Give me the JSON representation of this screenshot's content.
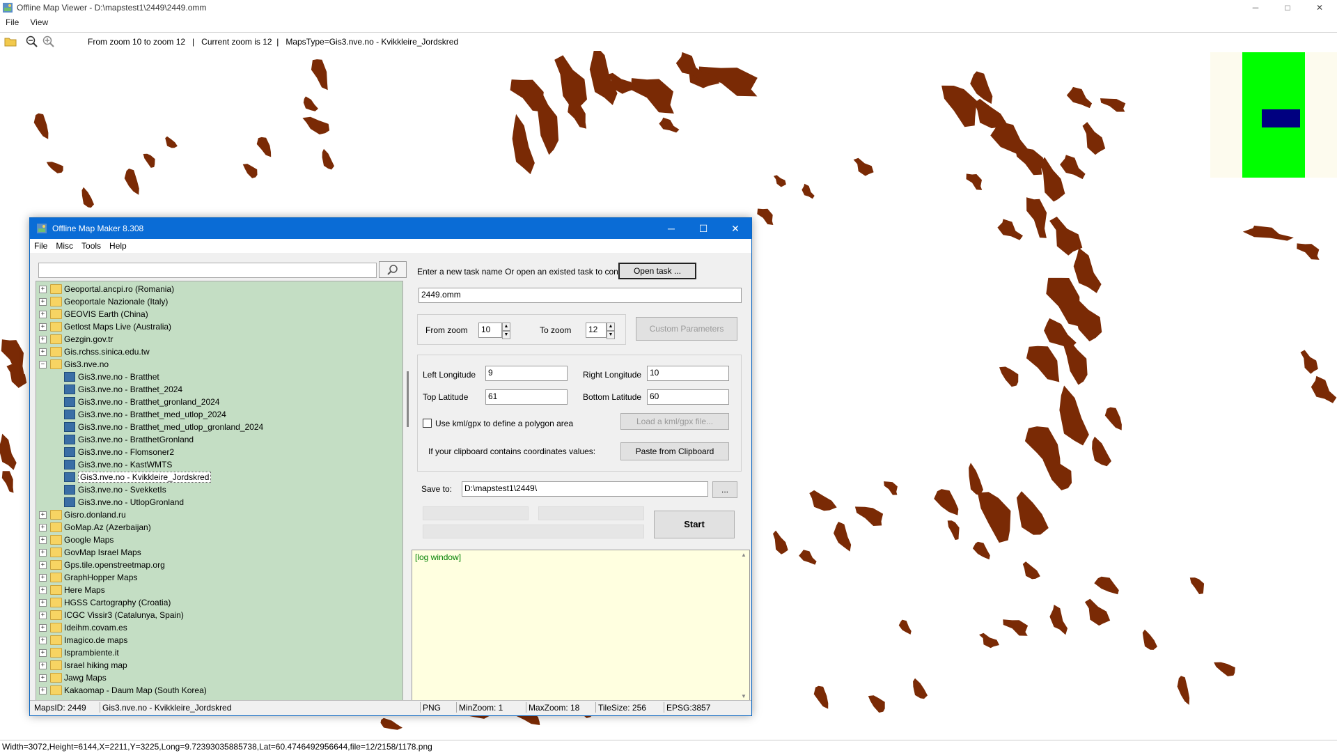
{
  "viewer": {
    "title": "Offline Map Viewer - D:\\mapstest1\\2449\\2449.omm",
    "menu": [
      "File",
      "View"
    ],
    "toolbar_info": "From zoom 10 to zoom 12   |   Current zoom is 12  |   MapsType=Gis3.nve.no - Kvikkleire_Jordskred",
    "status": "Width=3072,Height=6144,X=2211,Y=3225,Long=9.72393035885738,Lat=60.4746492956644,file=12/2158/1178.png",
    "window_controls": {
      "minimize": "─",
      "maximize": "□",
      "close": "✕"
    },
    "map_feature_color": "#7a2a05",
    "icons": [
      "open-folder-icon",
      "zoom-out-icon",
      "zoom-in-icon"
    ]
  },
  "dialog": {
    "title": "Offline Map Maker 8.308",
    "menu": [
      "File",
      "Misc",
      "Tools",
      "Help"
    ],
    "window_controls": {
      "minimize": "─",
      "maximize": "☐",
      "close": "✕"
    },
    "tree": [
      {
        "label": "Geoportal.ancpi.ro (Romania)",
        "level": 0,
        "type": "folder",
        "exp": "+"
      },
      {
        "label": "Geoportale Nazionale (Italy)",
        "level": 0,
        "type": "folder",
        "exp": "+"
      },
      {
        "label": "GEOVIS Earth (China)",
        "level": 0,
        "type": "folder",
        "exp": "+"
      },
      {
        "label": "Getlost Maps Live (Australia)",
        "level": 0,
        "type": "folder",
        "exp": "+"
      },
      {
        "label": "Gezgin.gov.tr",
        "level": 0,
        "type": "folder",
        "exp": "+"
      },
      {
        "label": "Gis.rchss.sinica.edu.tw",
        "level": 0,
        "type": "folder",
        "exp": "+"
      },
      {
        "label": "Gis3.nve.no",
        "level": 0,
        "type": "folder",
        "exp": "−"
      },
      {
        "label": "Gis3.nve.no - Bratthet",
        "level": 1,
        "type": "map"
      },
      {
        "label": "Gis3.nve.no - Bratthet_2024",
        "level": 1,
        "type": "map"
      },
      {
        "label": "Gis3.nve.no - Bratthet_gronland_2024",
        "level": 1,
        "type": "map"
      },
      {
        "label": "Gis3.nve.no - Bratthet_med_utlop_2024",
        "level": 1,
        "type": "map"
      },
      {
        "label": "Gis3.nve.no - Bratthet_med_utlop_gronland_2024",
        "level": 1,
        "type": "map"
      },
      {
        "label": "Gis3.nve.no - BratthetGronland",
        "level": 1,
        "type": "map"
      },
      {
        "label": "Gis3.nve.no - Flomsoner2",
        "level": 1,
        "type": "map"
      },
      {
        "label": "Gis3.nve.no - KastWMTS",
        "level": 1,
        "type": "map"
      },
      {
        "label": "Gis3.nve.no - Kvikkleire_Jordskred",
        "level": 1,
        "type": "map",
        "selected": true
      },
      {
        "label": "Gis3.nve.no - SvekketIs",
        "level": 1,
        "type": "map"
      },
      {
        "label": "Gis3.nve.no - UtlopGronland",
        "level": 1,
        "type": "map"
      },
      {
        "label": "Gisro.donland.ru",
        "level": 0,
        "type": "folder",
        "exp": "+"
      },
      {
        "label": "GoMap.Az (Azerbaijan)",
        "level": 0,
        "type": "folder",
        "exp": "+"
      },
      {
        "label": "Google Maps",
        "level": 0,
        "type": "folder",
        "exp": "+"
      },
      {
        "label": "GovMap Israel Maps",
        "level": 0,
        "type": "folder",
        "exp": "+"
      },
      {
        "label": "Gps.tile.openstreetmap.org",
        "level": 0,
        "type": "folder",
        "exp": "+"
      },
      {
        "label": "GraphHopper Maps",
        "level": 0,
        "type": "folder",
        "exp": "+"
      },
      {
        "label": "Here Maps",
        "level": 0,
        "type": "folder",
        "exp": "+"
      },
      {
        "label": "HGSS Cartography (Croatia)",
        "level": 0,
        "type": "folder",
        "exp": "+"
      },
      {
        "label": "ICGC Vissir3 (Catalunya, Spain)",
        "level": 0,
        "type": "folder",
        "exp": "+"
      },
      {
        "label": "Ideihm.covam.es",
        "level": 0,
        "type": "folder",
        "exp": "+"
      },
      {
        "label": "Imagico.de maps",
        "level": 0,
        "type": "folder",
        "exp": "+"
      },
      {
        "label": "Isprambiente.it",
        "level": 0,
        "type": "folder",
        "exp": "+"
      },
      {
        "label": "Israel hiking map",
        "level": 0,
        "type": "folder",
        "exp": "+"
      },
      {
        "label": "Jawg Maps",
        "level": 0,
        "type": "folder",
        "exp": "+"
      },
      {
        "label": "Kakaomap - Daum Map (South Korea)",
        "level": 0,
        "type": "folder",
        "exp": "+"
      }
    ],
    "task": {
      "prompt": "Enter a new task name Or open an existed task to continue:",
      "open_button": "Open task ...",
      "name_value": "2449.omm"
    },
    "zoom": {
      "from_label": "From zoom",
      "from_value": "10",
      "to_label": "To zoom",
      "to_value": "12",
      "custom_button": "Custom Parameters"
    },
    "coords": {
      "left_lon_label": "Left Longitude",
      "left_lon": "9",
      "right_lon_label": "Right Longitude",
      "right_lon": "10",
      "top_lat_label": "Top Latitude",
      "top_lat": "61",
      "bottom_lat_label": "Bottom Latitude",
      "bottom_lat": "60",
      "kml_label": "Use kml/gpx to define a polygon area",
      "kml_button": "Load a kml/gpx file...",
      "clipboard_label": "If your clipboard contains coordinates values:",
      "clipboard_button": "Paste from Clipboard"
    },
    "save": {
      "label": "Save to:",
      "path": "D:\\mapstest1\\2449\\",
      "browse": "..."
    },
    "start_button": "Start",
    "log_text": "[log window]",
    "status": {
      "maps_id": "MapsID: 2449",
      "map_name": "Gis3.nve.no - Kvikkleire_Jordskred",
      "format": "PNG",
      "min_zoom": "MinZoom: 1",
      "max_zoom": "MaxZoom: 18",
      "tile_size": "TileSize: 256",
      "epsg": "EPSG:3857"
    }
  }
}
